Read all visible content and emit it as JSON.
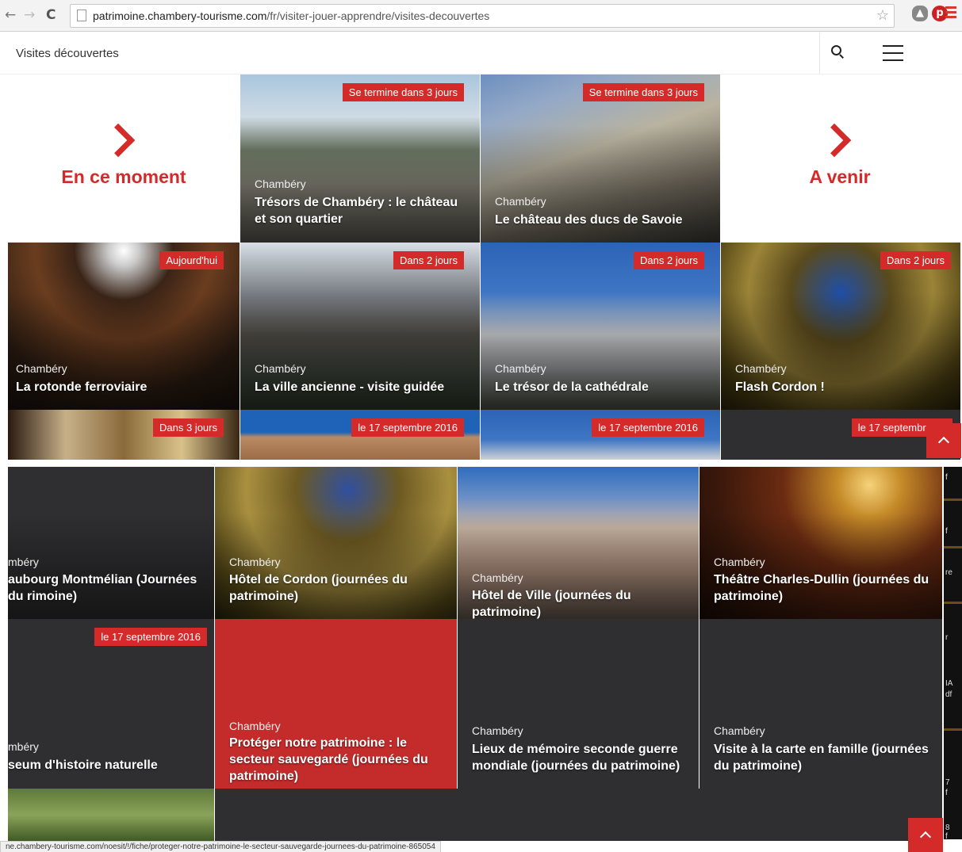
{
  "browser": {
    "url_host": "patrimoine.chambery-tourisme.com",
    "url_path": "/fr/visiter-jouer-apprendre/visites-decouvertes",
    "status_url": "ne.chambery-tourisme.com/noesit/!/fiche/proteger-notre-patrimoine-le-secteur-sauvegarde-journees-du-patrimoine-865054"
  },
  "header": {
    "title": "Visites découvertes"
  },
  "features": {
    "now": "En ce moment",
    "upcoming": "A venir"
  },
  "tiles_top": [
    {
      "badge": "Se termine dans 3 jours",
      "city": "Chambéry",
      "title": "Trésors de Chambéry : le château et son quartier"
    },
    {
      "badge": "Se termine dans 3 jours",
      "city": "Chambéry",
      "title": "Le château des ducs de Savoie"
    },
    {
      "badge": "Aujourd'hui",
      "city": "Chambéry",
      "title": "La rotonde ferroviaire"
    },
    {
      "badge": "Dans 2 jours",
      "city": "Chambéry",
      "title": "La ville ancienne - visite guidée"
    },
    {
      "badge": "Dans 2 jours",
      "city": "Chambéry",
      "title": "Le trésor de la cathédrale"
    },
    {
      "badge": "Dans 2 jours",
      "city": "Chambéry",
      "title": "Flash Cordon !"
    },
    {
      "badge": "Dans 3 jours"
    },
    {
      "badge": "le 17 septembre 2016"
    },
    {
      "badge": "le 17 septembre 2016"
    },
    {
      "badge": "le 17 septembre 20"
    }
  ],
  "tiles_bottom": [
    {
      "city": "mbéry",
      "title": "aubourg Montmélian (Journées du rimoine)"
    },
    {
      "city": "Chambéry",
      "title": "Hôtel de Cordon (journées du patrimoine)"
    },
    {
      "city": "Chambéry",
      "title": "Hôtel de Ville (journées du patrimoine)"
    },
    {
      "city": "Chambéry",
      "title": "Théâtre Charles-Dullin (journées du patrimoine)"
    },
    {
      "badge": "le 17 septembre 2016",
      "city": "mbéry",
      "title": "seum d'histoire naturelle"
    },
    {
      "city": "Chambéry",
      "title": "Protéger notre patrimoine : le secteur sauvegardé (journées du patrimoine)"
    },
    {
      "city": "Chambéry",
      "title": "Lieux de mémoire seconde guerre mondiale (journées du patrimoine)"
    },
    {
      "city": "Chambéry",
      "title": "Visite à la carte en famille (journées du patrimoine)"
    }
  ],
  "right_strip": [
    "f",
    "f",
    "re",
    "r",
    "IA",
    "df",
    "7",
    "f",
    "8",
    "f"
  ],
  "colors": {
    "accent": "#d42a2a",
    "dark_tile": "#2f2f31",
    "highlight_tile": "#c42c2c"
  },
  "icons": [
    "back-arrow-icon",
    "forward-arrow-icon",
    "reload-icon",
    "page-icon",
    "star-icon",
    "cloud-extension-icon",
    "pinterest-icon",
    "chrome-menu-icon",
    "search-icon",
    "hamburger-icon",
    "chevron-right-icon",
    "chevron-up-icon"
  ]
}
